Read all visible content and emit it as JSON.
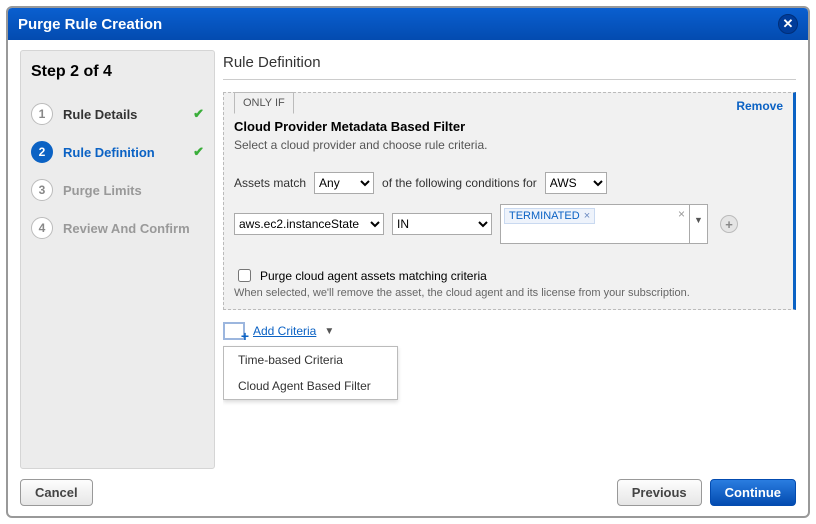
{
  "window_title": "Purge Rule Creation",
  "sidebar": {
    "step_title": "Step 2 of 4",
    "steps": [
      {
        "num": "1",
        "label": "Rule Details"
      },
      {
        "num": "2",
        "label": "Rule Definition"
      },
      {
        "num": "3",
        "label": "Purge Limits"
      },
      {
        "num": "4",
        "label": "Review And Confirm"
      }
    ]
  },
  "main": {
    "title": "Rule Definition",
    "only_if": "ONLY IF",
    "remove": "Remove",
    "filter_title": "Cloud Provider Metadata Based Filter",
    "filter_sub": "Select a cloud provider and choose rule criteria.",
    "assets_match_label": "Assets match",
    "match_mode": "Any",
    "conditions_label": "of the following conditions for",
    "provider": "AWS",
    "rule": {
      "attribute": "aws.ec2.instanceState",
      "operator": "IN",
      "value_tag": "TERMINATED"
    },
    "purge_checkbox_label": "Purge cloud agent assets matching criteria",
    "purge_note": "When selected, we'll remove the asset, the cloud agent and its license from your subscription.",
    "add_criteria": "Add Criteria",
    "menu": {
      "item1": "Time-based Criteria",
      "item2": "Cloud Agent Based Filter"
    }
  },
  "footer": {
    "cancel": "Cancel",
    "previous": "Previous",
    "continue": "Continue"
  }
}
